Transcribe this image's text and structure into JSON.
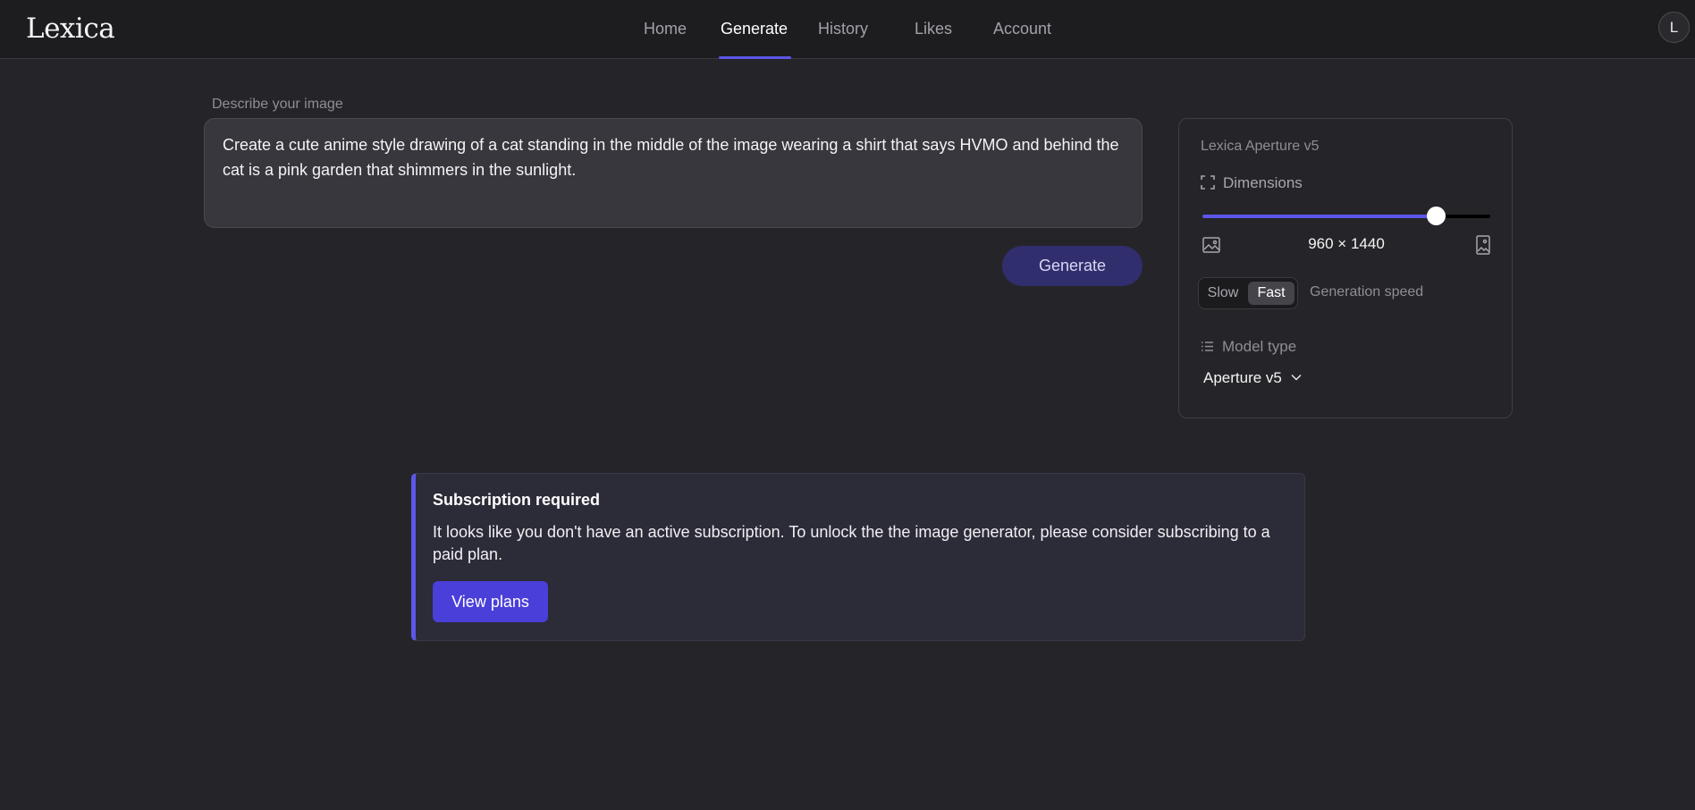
{
  "header": {
    "logo": "Lexica",
    "nav": [
      {
        "label": "Home"
      },
      {
        "label": "Generate",
        "active": true
      },
      {
        "label": "History"
      },
      {
        "label": "Likes"
      },
      {
        "label": "Account"
      }
    ],
    "avatar_initial": "L"
  },
  "prompt": {
    "label": "Describe your image",
    "value": "Create a cute anime style drawing of a cat standing in the middle of the image wearing a shirt that says HVMO and behind the cat is a pink garden that shimmers in the sunlight.",
    "generate_label": "Generate"
  },
  "settings": {
    "model_title": "Lexica Aperture v5",
    "dimensions_label": "Dimensions",
    "dimensions_value": "960 × 1440",
    "slider_fraction": 0.81,
    "speed": {
      "slow_label": "Slow",
      "fast_label": "Fast",
      "selected": "Fast",
      "label": "Generation speed"
    },
    "model_type_label": "Model type",
    "model_type_value": "Aperture v5"
  },
  "notice": {
    "title": "Subscription required",
    "text": "It looks like you don't have an active subscription. To unlock the the image generator, please consider subscribing to a paid plan.",
    "button_label": "View plans"
  },
  "colors": {
    "accent": "#5b57e8",
    "background": "#252428",
    "button_primary": "#4a3fd9"
  },
  "icons": [
    "expand-icon",
    "landscape-image-icon",
    "portrait-image-icon",
    "list-icon",
    "chevron-down-icon"
  ]
}
